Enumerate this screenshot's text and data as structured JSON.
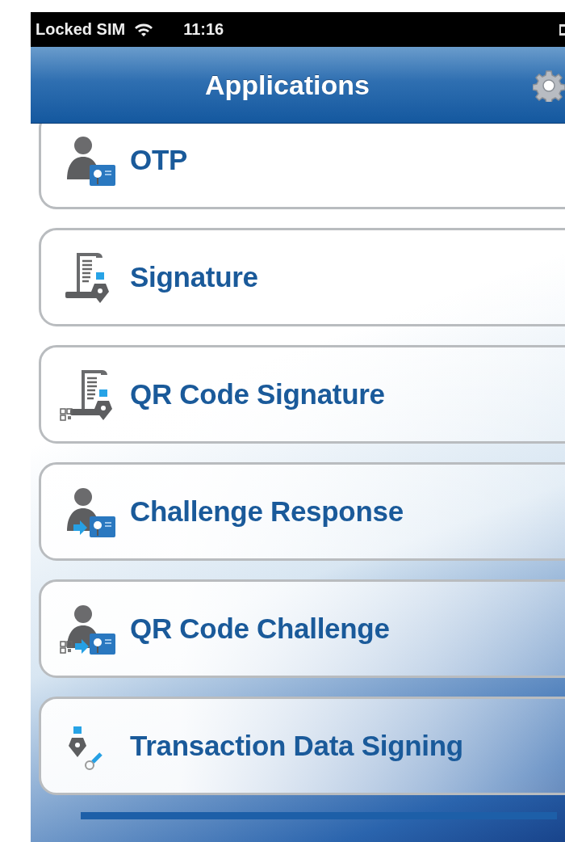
{
  "status_bar": {
    "carrier": "Locked SIM",
    "time": "11:16"
  },
  "nav_bar": {
    "title": "Applications"
  },
  "applications": [
    {
      "label": "OTP",
      "kind": "person-card"
    },
    {
      "label": "Signature",
      "kind": "document-pen"
    },
    {
      "label": "QR Code Signature",
      "kind": "qr-document-pen"
    },
    {
      "label": "Challenge Response",
      "kind": "arrow-person-card"
    },
    {
      "label": "QR Code Challenge",
      "kind": "qr-arrow-person-card"
    },
    {
      "label": "Transaction Data Signing",
      "kind": "pen-link"
    }
  ]
}
